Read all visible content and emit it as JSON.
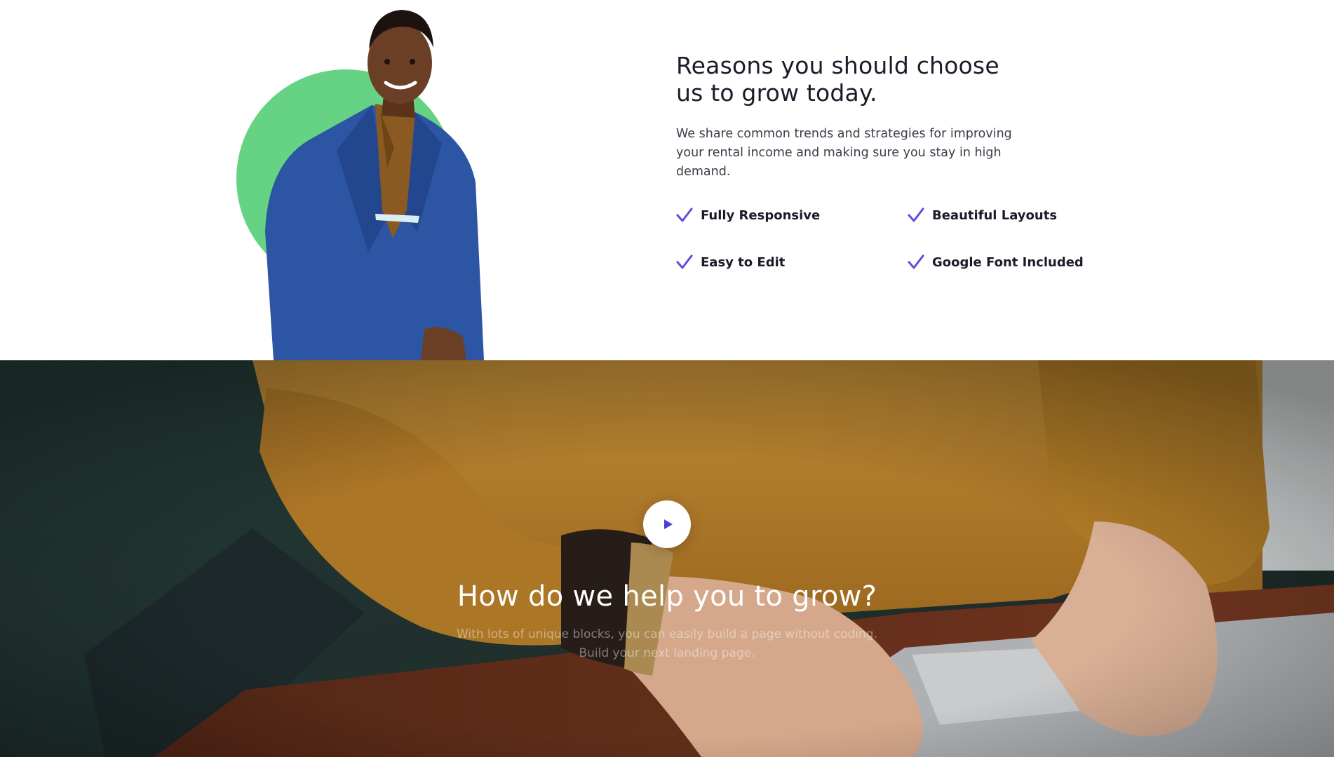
{
  "features_section": {
    "headline": "Reasons you should choose us to grow today.",
    "intro": "We share common trends and strategies for improving your rental income and making sure you stay in high demand.",
    "features": [
      {
        "label": "Fully Responsive",
        "icon": "check-icon"
      },
      {
        "label": "Beautiful Layouts",
        "icon": "check-icon"
      },
      {
        "label": "Easy to Edit",
        "icon": "check-icon"
      },
      {
        "label": "Google Font Included",
        "icon": "check-icon"
      }
    ],
    "colors": {
      "accent_circle": "#66d384",
      "check": "#5b4ee0",
      "suit": "#2c55a3"
    }
  },
  "video_section": {
    "play_icon": "play-icon",
    "title": "How do we help you to grow?",
    "subtitle_line1": "With lots of unique blocks, you can easily build a page without coding.",
    "subtitle_line2": "Build your next landing page.",
    "colors": {
      "play": "#4a3fd6",
      "sweater": "#c48a2e"
    }
  }
}
